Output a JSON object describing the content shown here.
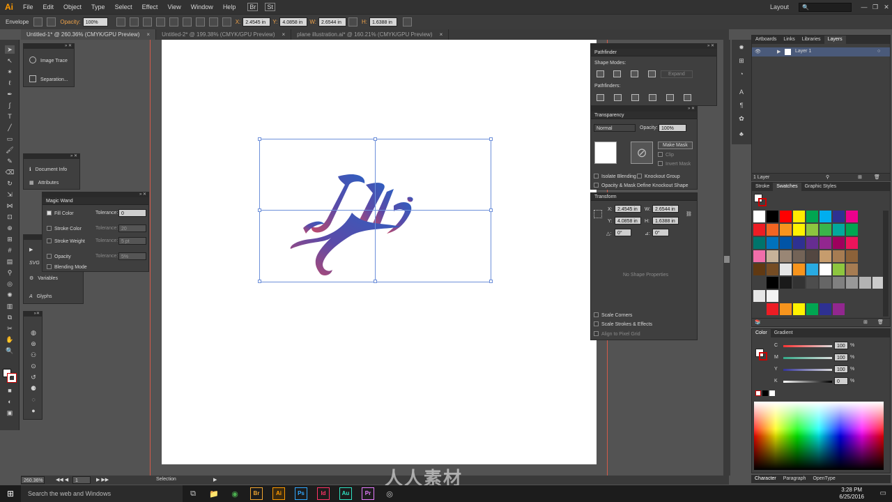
{
  "app": {
    "logo": "Ai"
  },
  "menu": [
    "File",
    "Edit",
    "Object",
    "Type",
    "Select",
    "Effect",
    "View",
    "Window",
    "Help"
  ],
  "menu_right": {
    "layout": "Layout",
    "minimize": "—",
    "restore": "❐",
    "close": "✕"
  },
  "control_bar": {
    "mode": "Envelope",
    "opacity_label": "Opacity:",
    "opacity_value": "100%",
    "x_label": "X:",
    "x_value": "2.4545 in",
    "y_label": "Y:",
    "y_value": "4.0858 in",
    "w_label": "W:",
    "w_value": "2.6544 in",
    "h_label": "H:",
    "h_value": "1.6388 in",
    "br": "Br",
    "st": "St"
  },
  "tabs": [
    {
      "label": "Untitled-1* @ 260.36% (CMYK/GPU Preview)",
      "close": "×"
    },
    {
      "label": "Untitled-2* @ 199.38% (CMYK/GPU Preview)",
      "close": "×"
    },
    {
      "label": "plane illustration.ai* @ 160.21% (CMYK/GPU Preview)",
      "close": "×"
    }
  ],
  "left_panels": {
    "image_trace": "Image Trace",
    "separations": "Separation...",
    "document_info": "Document Info",
    "attributes": "Attributes",
    "svg": "SVG",
    "variables": "Variables",
    "glyphs": "Glyphs"
  },
  "magic_wand": {
    "title": "Magic Wand",
    "fill_color": "Fill Color",
    "stroke_color": "Stroke Color",
    "stroke_weight": "Stroke Weight",
    "opacity": "Opacity",
    "blending_mode": "Blending Mode",
    "tolerance": "Tolerance:",
    "fill_tol": "0",
    "stroke_tol": "20",
    "weight_tol": "5 pt",
    "opacity_tol": "5%"
  },
  "pathfinder": {
    "title": "Pathfinder",
    "shape_modes": "Shape Modes:",
    "pathfinders": "Pathfinders:",
    "expand": "Expand"
  },
  "transparency": {
    "title": "Transparency",
    "mode": "Normal",
    "opacity_label": "Opacity:",
    "opacity_value": "100%",
    "make_mask": "Make Mask",
    "clip": "Clip",
    "invert_mask": "Invert Mask",
    "isolate_blending": "Isolate Blending",
    "knockout_group": "Knockout Group",
    "opacity_mask": "Opacity & Mask Define Knockout Shape"
  },
  "transform": {
    "title": "Transform",
    "x_label": "X:",
    "x_value": "2.4545 in",
    "w_label": "W:",
    "w_value": "2.6544 in",
    "y_label": "Y:",
    "y_value": "4.0858 in",
    "h_label": "H:",
    "h_value": "1.6388 in",
    "angle_label": "△:",
    "angle_value": "0°",
    "shear_label": "⊿:",
    "shear_value": "0°",
    "no_shape": "No Shape Properties",
    "scale_corners": "Scale Corners",
    "scale_strokes": "Scale Strokes & Effects",
    "align_pixel": "Align to Pixel Grid"
  },
  "layers_panel": {
    "tabs": [
      "Artboards",
      "Links",
      "Libraries",
      "Layers"
    ],
    "layer_name": "Layer 1",
    "count": "1 Layer"
  },
  "swatches_panel": {
    "tabs": [
      "Stroke",
      "Swatches",
      "Graphic Styles"
    ],
    "colors_row1": [
      "#ffffff",
      "#000000",
      "#ff0000",
      "#ffeb00",
      "#00a651",
      "#00aeef",
      "#2e3192",
      "#ec008c"
    ],
    "colors_row2": [
      "#ed1c24",
      "#f26522",
      "#f7941d",
      "#fff200",
      "#8dc63f",
      "#39b54a",
      "#00a99d",
      "#00a651"
    ],
    "colors_row3": [
      "#00746b",
      "#0072bc",
      "#0054a6",
      "#2e3192",
      "#662d91",
      "#92278f",
      "#9e005d",
      "#ed145b"
    ],
    "colors_row4": [
      "#f06eaa",
      "#c7b299",
      "#998675",
      "#736357",
      "#534741",
      "#c69c6d",
      "#a67c52",
      "#8c6239"
    ],
    "colors_row5": [
      "#603913",
      "#754c24",
      "#e6e6e6",
      "#f7941d",
      "#29abe2",
      "#ffffff",
      "#8dc63f",
      "#a67c52"
    ],
    "grays": [
      "#000000",
      "#1a1a1a",
      "#333333",
      "#4d4d4d",
      "#666666",
      "#808080",
      "#999999",
      "#b3b3b3",
      "#cccccc"
    ],
    "grays2": [
      "#e6e6e6",
      "#f2f2f2"
    ],
    "bright": [
      "#ed1c24",
      "#f7941d",
      "#fff200",
      "#00a651",
      "#2e3192",
      "#92278f"
    ]
  },
  "color_panel": {
    "tabs": [
      "Color",
      "Gradient"
    ],
    "channels": [
      {
        "label": "C",
        "value": "100",
        "unit": "%"
      },
      {
        "label": "M",
        "value": "100",
        "unit": "%"
      },
      {
        "label": "Y",
        "value": "100",
        "unit": "%"
      },
      {
        "label": "K",
        "value": "0",
        "unit": "%"
      }
    ]
  },
  "bottom_tabs": [
    "Character",
    "Paragraph",
    "OpenType"
  ],
  "status": {
    "zoom": "260.36%",
    "page": "1",
    "tool": "Selection"
  },
  "taskbar": {
    "search": "Search the web and Windows",
    "apps": [
      {
        "label": "Br",
        "color": "#f2a630"
      },
      {
        "label": "Ai",
        "color": "#ff9a00"
      },
      {
        "label": "Ps",
        "color": "#31a8ff"
      },
      {
        "label": "Id",
        "color": "#ff3366"
      },
      {
        "label": "Au",
        "color": "#2fe3c4"
      },
      {
        "label": "Pr",
        "color": "#e77cff"
      }
    ],
    "time": "3:28 PM",
    "date": "6/25/2016"
  },
  "watermark": "人人素材"
}
